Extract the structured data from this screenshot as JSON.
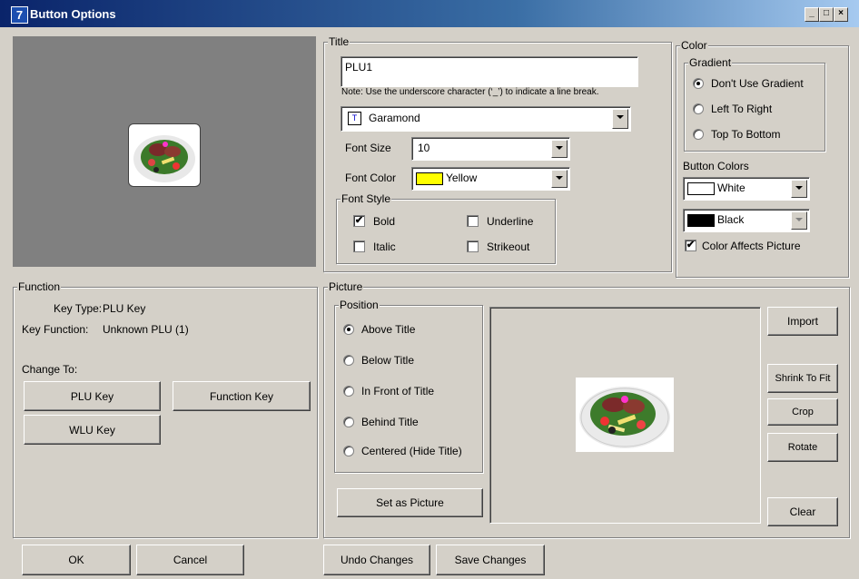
{
  "window": {
    "title": "Button Options",
    "controls": [
      "_",
      "□",
      "×"
    ]
  },
  "title_group": {
    "legend": "Title",
    "title_value": "PLU1",
    "note": "Note: Use the underscore character (‘_’) to indicate a line break.",
    "font_name": "Garamond",
    "font_size_label": "Font Size",
    "font_size_value": "10",
    "font_color_label": "Font Color",
    "font_color_value": "Yellow",
    "font_color_hex": "#ffff00",
    "font_style": {
      "legend": "Font Style",
      "bold": "Bold",
      "italic": "Italic",
      "underline": "Underline",
      "strikeout": "Strikeout",
      "bold_checked": true,
      "italic_checked": false,
      "underline_checked": false,
      "strikeout_checked": false
    }
  },
  "color_group": {
    "legend": "Color",
    "gradient_legend": "Gradient",
    "gradient_options": [
      "Don't Use Gradient",
      "Left To Right",
      "Top To Bottom"
    ],
    "gradient_selected": 0,
    "button_colors_label": "Button Colors",
    "button_color_1": "White",
    "button_color_1_hex": "#ffffff",
    "button_color_2": "Black",
    "button_color_2_hex": "#000000",
    "color_affects_picture": "Color Affects Picture",
    "color_affects_picture_checked": true
  },
  "function_group": {
    "legend": "Function",
    "key_type_label": "Key Type:",
    "key_type_value": "PLU Key",
    "key_function_label": "Key Function:",
    "key_function_value": "Unknown PLU (1)",
    "change_to": "Change To:",
    "plu_key": "PLU Key",
    "function_key": "Function Key",
    "wlu_key": "WLU Key"
  },
  "picture_group": {
    "legend": "Picture",
    "position_legend": "Position",
    "position_options": [
      "Above Title",
      "Below Title",
      "In Front of Title",
      "Behind Title",
      "Centered (Hide Title)"
    ],
    "position_selected": 0,
    "set_as_picture": "Set as Picture",
    "import": "Import",
    "shrink_to_fit": "Shrink To Fit",
    "crop": "Crop",
    "rotate": "Rotate",
    "clear": "Clear"
  },
  "footer": {
    "ok": "OK",
    "cancel": "Cancel",
    "undo": "Undo Changes",
    "save": "Save Changes"
  },
  "icons": {
    "app": "app-icon",
    "font": "font-icon",
    "picture": "salad-image"
  }
}
